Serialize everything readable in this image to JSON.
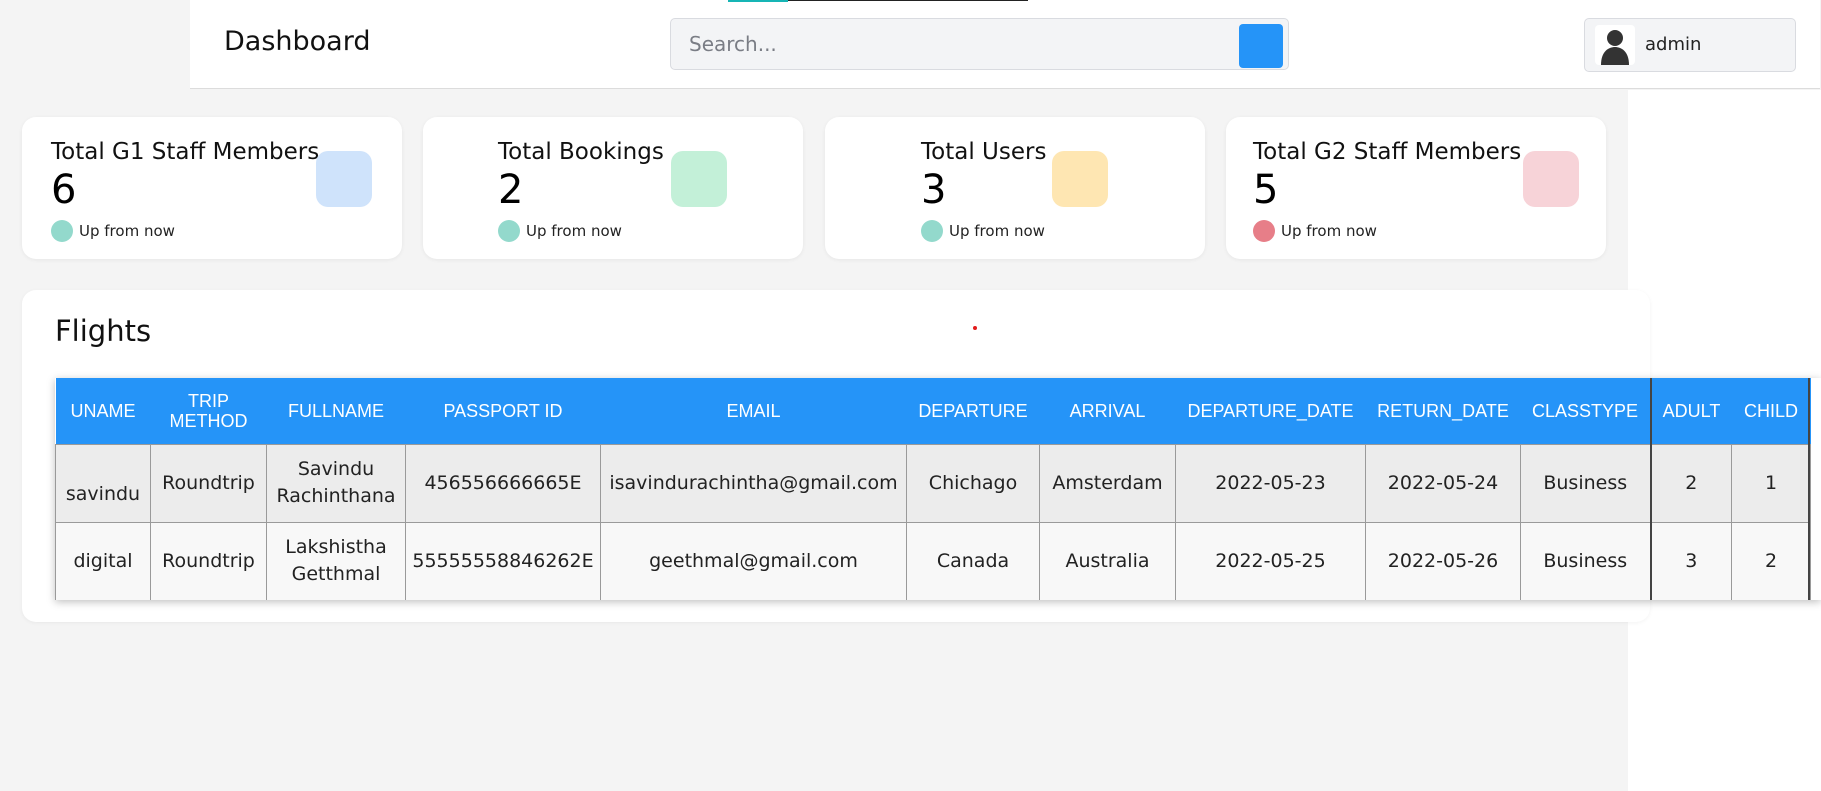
{
  "header": {
    "title": "Dashboard",
    "search_placeholder": "Search...",
    "user_name": "admin"
  },
  "stats": [
    {
      "title": "Total G1 Staff Members",
      "value": "6",
      "sub": "Up from now",
      "dot_color": "#93d9cc",
      "icon_color": "#cfe3fb"
    },
    {
      "title": "Total Bookings",
      "value": "2",
      "sub": "Up from now",
      "dot_color": "#93d9cc",
      "icon_color": "#c3f0d8"
    },
    {
      "title": "Total Users",
      "value": "3",
      "sub": "Up from now",
      "dot_color": "#93d9cc",
      "icon_color": "#fee6b2"
    },
    {
      "title": "Total G2 Staff Members",
      "value": "5",
      "sub": "Up from now",
      "dot_color": "#e77e88",
      "icon_color": "#f7d3d8"
    }
  ],
  "flights": {
    "title": "Flights",
    "columns": [
      "UNAME",
      "TRIP METHOD",
      "FULLNAME",
      "PASSPORT ID",
      "EMAIL",
      "DEPARTURE",
      "ARRIVAL",
      "DEPARTURE_DATE",
      "RETURN_DATE",
      "CLASSTYPE",
      "ADULT",
      "CHILD"
    ],
    "rows": [
      [
        "savindu",
        "Roundtrip",
        "Savindu Rachinthana",
        "456556666665E",
        "isavindurachintha@gmail.com",
        "Chichago",
        "Amsterdam",
        "2022-05-23",
        "2022-05-24",
        "Business",
        "2",
        "1"
      ],
      [
        "digital",
        "Roundtrip",
        "Lakshistha Getthmal",
        "55555558846262E",
        "geethmal@gmail.com",
        "Canada",
        "Australia",
        "2022-05-25",
        "2022-05-26",
        "Business",
        "3",
        "2"
      ]
    ]
  },
  "colors": {
    "accent": "#2594f8",
    "background": "#f4f4f4"
  }
}
